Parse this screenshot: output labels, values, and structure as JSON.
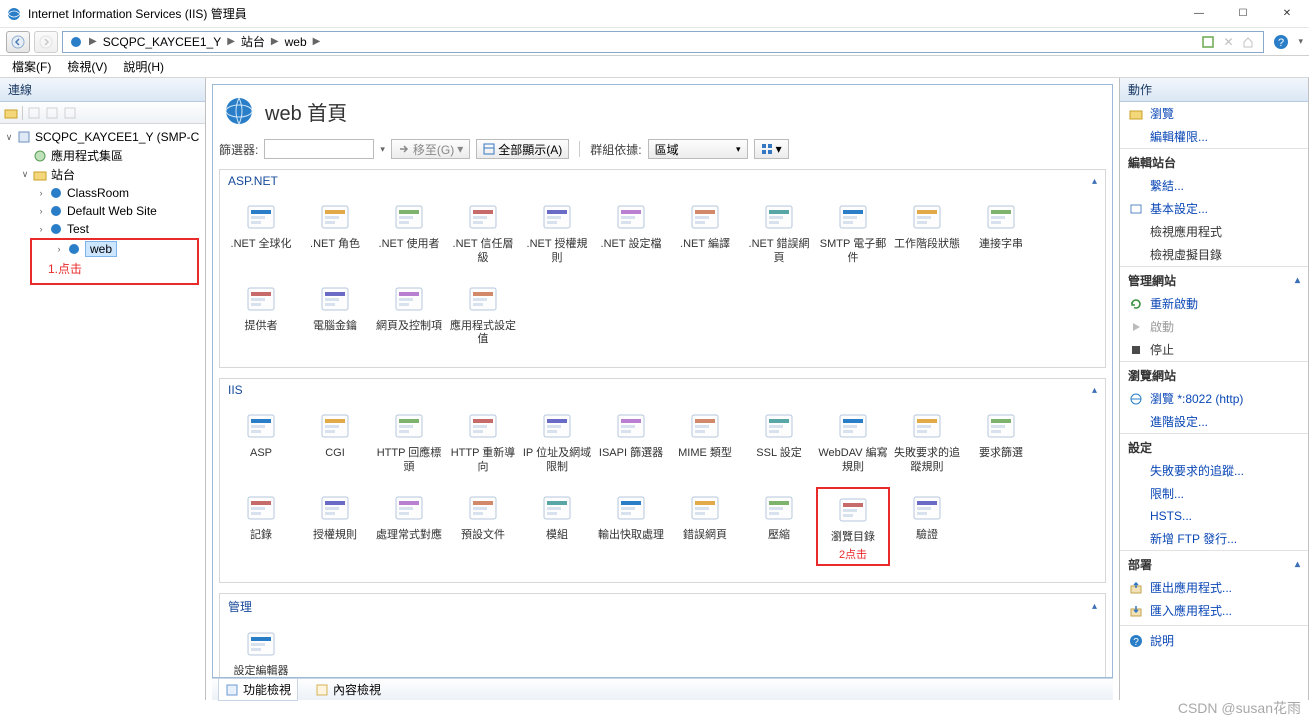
{
  "window": {
    "title": "Internet Information Services (IIS) 管理員",
    "min": "—",
    "max": "☐",
    "close": "✕"
  },
  "nav": {
    "back": "←",
    "fwd": "→"
  },
  "breadcrumb": {
    "root": "SCQPC_KAYCEE1_Y",
    "lvl1": "站台",
    "lvl2": "web"
  },
  "menu": {
    "file": "檔案(F)",
    "view": "檢視(V)",
    "help": "說明(H)"
  },
  "left": {
    "header": "連線",
    "nodes": {
      "server": "SCQPC_KAYCEE1_Y (SMP-C",
      "apppools": "應用程式集區",
      "sites": "站台",
      "site1": "ClassRoom",
      "site2": "Default Web Site",
      "site3": "Test",
      "site4": "web"
    },
    "annotation": "1.点击"
  },
  "center": {
    "title": "web 首頁",
    "filter_label": "篩選器:",
    "goto": "移至(G)",
    "showall": "全部顯示(A)",
    "groupby_label": "群組依據:",
    "groupby_value": "區域",
    "groups": {
      "aspnet": {
        "header": "ASP.NET",
        "items": [
          ".NET 全球化",
          ".NET 角色",
          ".NET 使用者",
          ".NET 信任層級",
          ".NET 授權規則",
          ".NET 設定檔",
          ".NET 編譯",
          ".NET 錯誤網頁",
          "SMTP 電子郵件",
          "工作階段狀態",
          "連接字串",
          "提供者",
          "電腦金鑰",
          "網頁及控制項",
          "應用程式設定值"
        ]
      },
      "iis": {
        "header": "IIS",
        "items": [
          "ASP",
          "CGI",
          "HTTP 回應標頭",
          "HTTP 重新導向",
          "IP 位址及網域限制",
          "ISAPI 篩選器",
          "MIME 類型",
          "SSL 設定",
          "WebDAV 編寫規則",
          "失敗要求的追蹤規則",
          "要求篩選",
          "記錄",
          "授權規則",
          "處理常式對應",
          "預設文件",
          "模組",
          "輸出快取處理",
          "錯誤網頁",
          "壓縮",
          "瀏覽目錄",
          "驗證"
        ],
        "annotation": "2点击",
        "annot_index": 19
      },
      "mgmt": {
        "header": "管理",
        "items": [
          "設定編輯器"
        ]
      }
    },
    "tabs": {
      "features": "功能檢視",
      "content": "內容檢視"
    }
  },
  "right": {
    "header": "動作",
    "explore": "瀏覽",
    "edit_perm": "編輯權限...",
    "sec_edit_site": "編輯站台",
    "bindings": "繫結...",
    "basic": "基本設定...",
    "view_apps": "檢視應用程式",
    "view_vdir": "檢視虛擬目錄",
    "sec_manage": "管理網站",
    "restart": "重新啟動",
    "start": "啟動",
    "stop": "停止",
    "sec_browse": "瀏覽網站",
    "browse_url": "瀏覽 *:8022 (http)",
    "advanced": "進階設定...",
    "sec_config": "設定",
    "failed_trace": "失敗要求的追蹤...",
    "limits": "限制...",
    "hsts": "HSTS...",
    "add_ftp": "新增 FTP 發行...",
    "sec_deploy": "部署",
    "export_app": "匯出應用程式...",
    "import_app": "匯入應用程式...",
    "help": "說明"
  },
  "watermark": "CSDN @susan花雨"
}
